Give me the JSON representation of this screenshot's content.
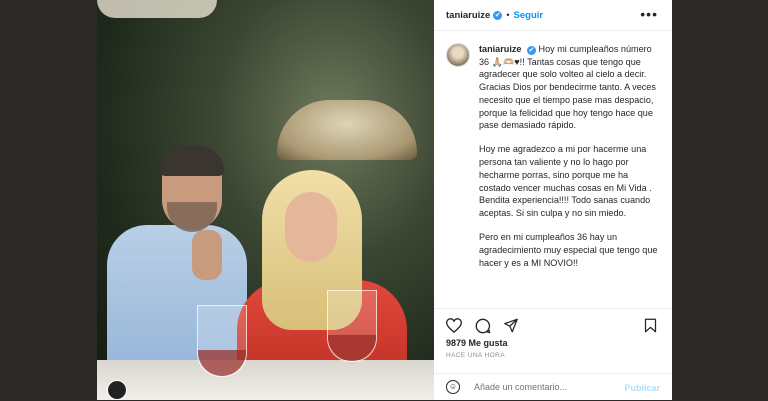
{
  "post": {
    "username": "taniaruize",
    "verified_mark": "✔",
    "separator": "•",
    "follow_label": "Seguir",
    "more_icon": "•••",
    "caption": {
      "username": "taniaruize",
      "verified_mark": "✔",
      "p1": "Hoy mi cumpleaños número 36 🙏🏼🫶🏼♥!! Tantas cosas que tengo que agradecer que solo volteo al cielo a decir. Gracias Dios por bendecirme tanto. A veces necesito que el tiempo pase mas despacio, porque la felicidad que hoy tengo hace que pase demasiado rápido.",
      "p2": "Hoy me agradezco a mi por hacerme una persona tan valiente y no lo hago por hecharme porras, sino porque me ha costado vencer muchas cosas en Mi Vida . Bendita experiencia!!!! Todo sanas cuando aceptas. Si sin culpa y no sin miedo.",
      "p3": "Pero en mi cumpleaños 36 hay un agradecimiento muy especial que tengo que hacer y es a MI NOVIO!!"
    },
    "actions": {
      "like_icon": "heart-icon",
      "comment_icon": "comment-icon",
      "share_icon": "share-icon",
      "save_icon": "bookmark-icon"
    },
    "likes": "9879 Me gusta",
    "timestamp": "HACE UNA HORA",
    "comment_placeholder": "Añade un comentario...",
    "publish_label": "Publicar"
  }
}
